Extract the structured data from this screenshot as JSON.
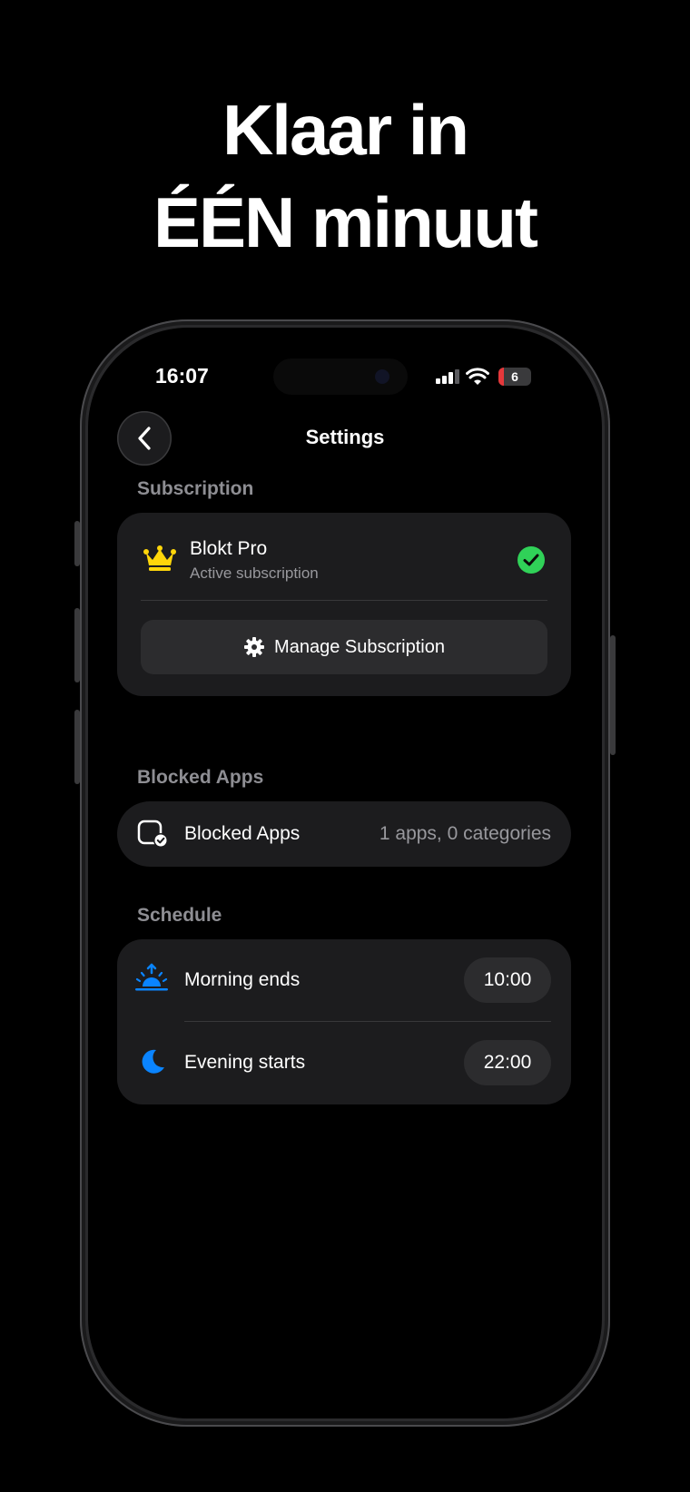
{
  "headline": {
    "line1": "Klaar in",
    "line2": "ÉÉN minuut"
  },
  "status_bar": {
    "time": "16:07",
    "battery_level": "6",
    "icons": [
      "signal-icon",
      "wifi-icon",
      "battery-icon"
    ]
  },
  "nav": {
    "title": "Settings",
    "back_icon": "chevron-left-icon"
  },
  "subscription": {
    "section_label": "Subscription",
    "plan_name": "Blokt Pro",
    "plan_status": "Active subscription",
    "plan_icon": "crown-icon",
    "status_icon": "check-circle-icon",
    "manage_label": "Manage Subscription",
    "manage_icon": "gear-icon"
  },
  "blocked_apps": {
    "section_label": "Blocked Apps",
    "row_label": "Blocked Apps",
    "row_value": "1 apps, 0 categories",
    "row_icon": "blocked-apps-icon"
  },
  "schedule": {
    "section_label": "Schedule",
    "items": [
      {
        "label": "Morning ends",
        "time": "10:00",
        "icon": "sunrise-icon"
      },
      {
        "label": "Evening starts",
        "time": "22:00",
        "icon": "moon-icon"
      }
    ]
  },
  "colors": {
    "accent_blue": "#0a84ff",
    "crown_gold": "#ffd60a",
    "success_green": "#30d158",
    "battery_red": "#e5383b"
  }
}
